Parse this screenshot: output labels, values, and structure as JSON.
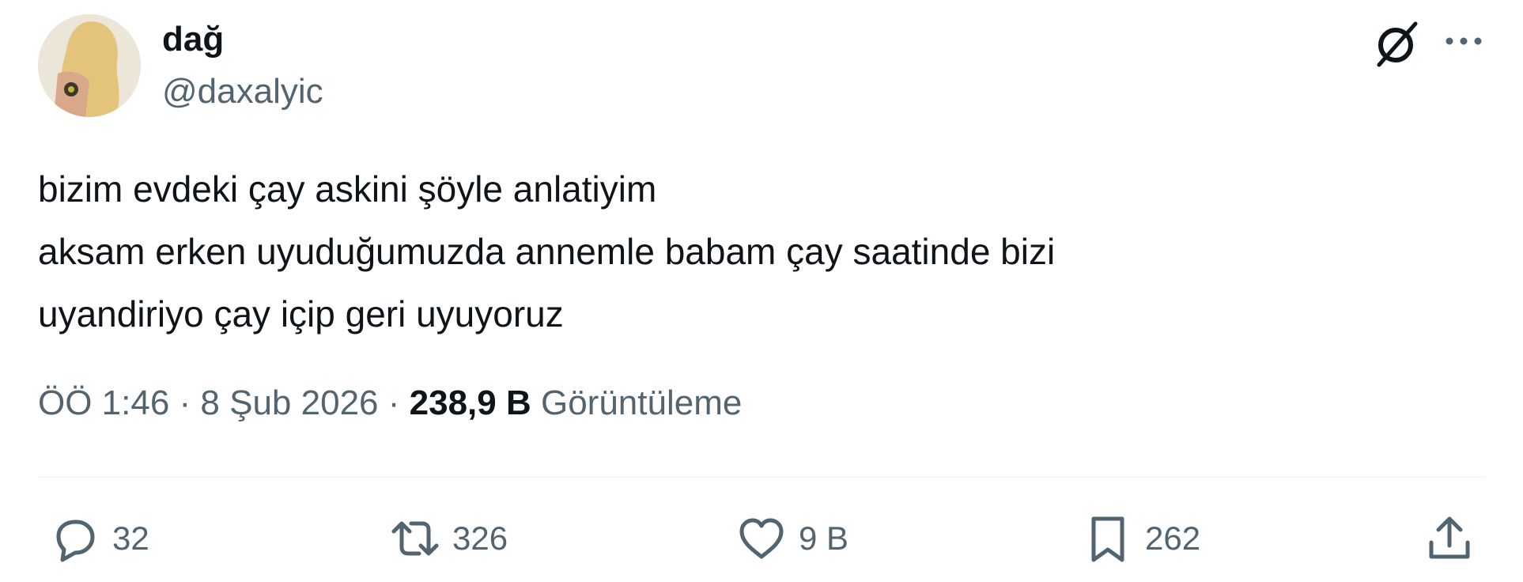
{
  "author": {
    "display_name": "dağ",
    "handle": "@daxalyic"
  },
  "tweet": {
    "lines": [
      "bizim evdeki çay askini şöyle anlatiyim",
      "aksam erken uyuduğumuzda annemle babam çay saatinde bizi",
      "uyandiriyo çay içip geri uyuyoruz"
    ]
  },
  "meta": {
    "time": "ÖÖ 1:46",
    "separator": " · ",
    "date": "8 Şub 2026",
    "views_count": "238,9 B",
    "views_label": "Görüntüleme"
  },
  "actions": {
    "reply_count": "32",
    "retweet_count": "326",
    "like_count": "9 B",
    "bookmark_count": "262"
  },
  "colors": {
    "text_primary": "#0f1419",
    "text_secondary": "#536471",
    "divider": "#eff3f4"
  },
  "icons": [
    "grok-icon",
    "more-dots-icon",
    "reply-icon",
    "retweet-icon",
    "like-icon",
    "bookmark-icon",
    "share-icon"
  ]
}
